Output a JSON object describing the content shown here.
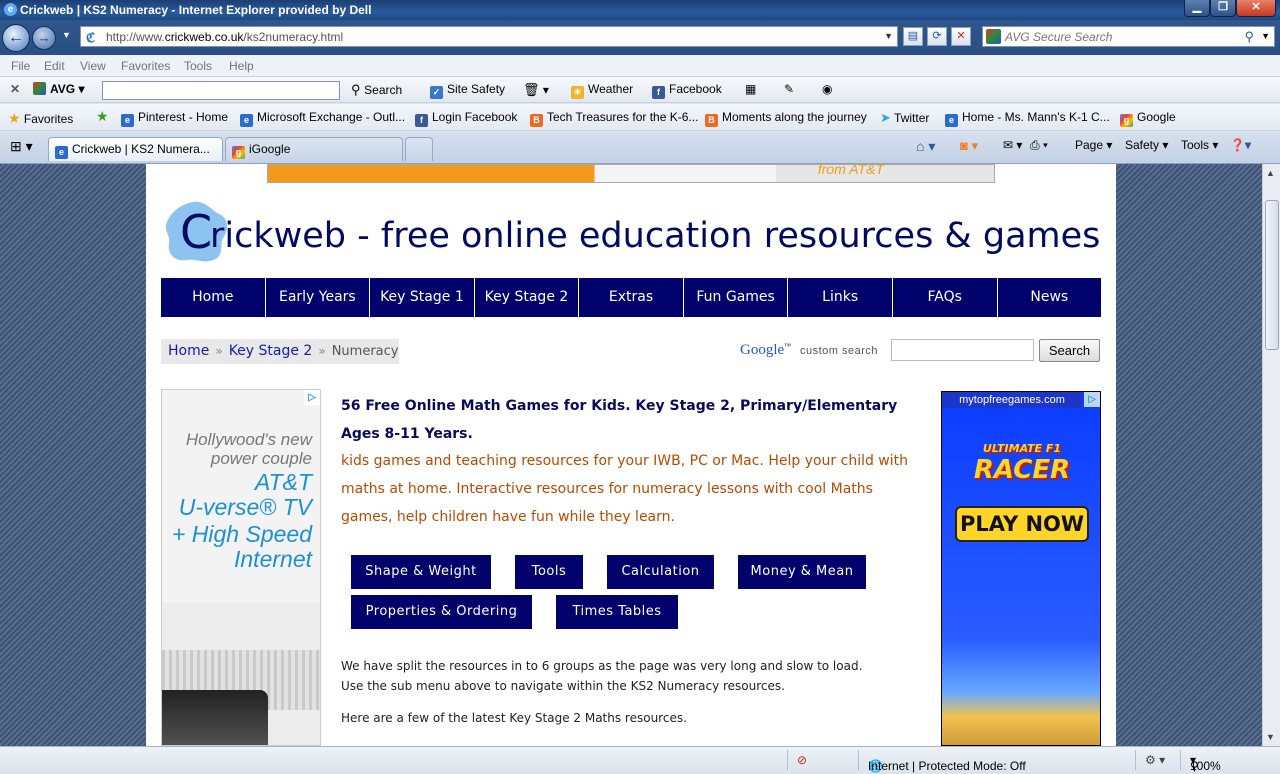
{
  "window": {
    "title": "Crickweb | KS2 Numeracy - Internet Explorer provided by Dell"
  },
  "address": {
    "url_prefix": "http://www.",
    "url_domain": "crickweb.co.uk",
    "url_path": "/ks2numeracy.html",
    "search_placeholder": "AVG Secure Search"
  },
  "menu": [
    "File",
    "Edit",
    "View",
    "Favorites",
    "Tools",
    "Help"
  ],
  "avg_toolbar": {
    "brand": "AVG",
    "search_label": "Search",
    "site_safety": "Site Safety",
    "weather": "Weather",
    "facebook": "Facebook"
  },
  "favorites_bar": {
    "favorites_label": "Favorites",
    "items": [
      "Pinterest - Home",
      "Microsoft Exchange - Outl...",
      "Login  Facebook",
      "Tech Treasures for the K-6...",
      "Moments along the journey",
      "Twitter",
      "Home - Ms. Mann's K-1 C...",
      "Google"
    ]
  },
  "tabs": [
    {
      "label": "Crickweb | KS2 Numera..."
    },
    {
      "label": "iGoogle"
    }
  ],
  "command_bar": {
    "page": "Page",
    "safety": "Safety",
    "tools": "Tools"
  },
  "site": {
    "logo_letter": "C",
    "title": "rickweb - free online education resources & games",
    "banner_text": "from AT&T",
    "nav": [
      "Home",
      "Early Years",
      "Key Stage 1",
      "Key Stage 2",
      "Extras",
      "Fun Games",
      "Links",
      "FAQs",
      "News"
    ],
    "breadcrumb": {
      "home": "Home",
      "sep": "»",
      "ks2": "Key Stage 2",
      "current": "Numeracy"
    },
    "google_logo": "Google",
    "custom_search": "custom search",
    "search_button": "Search",
    "heading": "56 Free Online Math Games for Kids. Key Stage 2, Primary/Elementary Ages 8-11 Years.",
    "subtext": "kids games and teaching resources for your IWB, PC or Mac. Help your child with maths at home. Interactive resources for numeracy lessons with cool Maths games, help children have fun while they learn.",
    "sub_buttons": [
      "Shape & Weight",
      "Tools",
      "Calculation",
      "Money & Mean",
      "Properties & Ordering",
      "Times Tables"
    ],
    "para1_line1": "We have split the resources in to 6 groups as the page was very long and slow to load.",
    "para1_line2": "Use the sub menu above to navigate within the KS2 Numeracy resources.",
    "para2": "Here are a few of the latest Key Stage 2 Maths resources."
  },
  "left_ad": {
    "line1": "Hollywood's new",
    "line2": "power couple",
    "line3": "AT&T",
    "line4": "U-verse® TV",
    "line5": "+ High Speed",
    "line6": "Internet"
  },
  "right_ad": {
    "source": "mytopfreegames.com",
    "game_line1": "ULTIMATE F1",
    "game_line2": "RACER",
    "play": "PLAY NOW"
  },
  "status": {
    "zone": "Internet | Protected Mode: Off",
    "zoom": "100%"
  }
}
